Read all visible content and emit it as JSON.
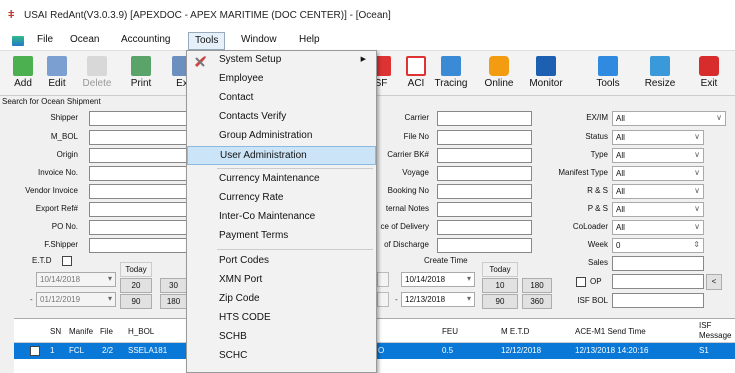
{
  "window": {
    "title": "USAI RedAnt(V3.0.3.9) [APEXDOC - APEX MARITIME (DOC CENTER)] - [Ocean]"
  },
  "menubar": {
    "items": [
      "File",
      "Ocean",
      "Accounting",
      "Tools",
      "Window",
      "Help"
    ]
  },
  "toolbar": {
    "add": "Add",
    "edit": "Edit",
    "delete": "Delete",
    "print": "Print",
    "export": "Ex",
    "isf": "SF",
    "aci": "ACI",
    "tracing": "Tracing",
    "online": "Online",
    "monitor": "Monitor",
    "tools": "Tools",
    "resize": "Resize",
    "exit": "Exit"
  },
  "search": {
    "title": "Search for Ocean Shipment",
    "left_labels": [
      "Shipper",
      "M_BOL",
      "Origin",
      "Invoice No.",
      "Vendor Invoice",
      "Export Ref#",
      "PO No.",
      "F.Shipper"
    ],
    "mid_labels": [
      "Carrier",
      "File No",
      "Carrier BK#",
      "Voyage",
      "Booking No",
      "ternal Notes",
      "ce of Delivery",
      "of Discharge"
    ],
    "right": [
      {
        "label": "EX/IM",
        "value": "All"
      },
      {
        "label": "Status",
        "value": "All"
      },
      {
        "label": "Type",
        "value": "All"
      },
      {
        "label": "Manifest Type",
        "value": "All"
      },
      {
        "label": "R & S",
        "value": "All"
      },
      {
        "label": "P & S",
        "value": "All"
      },
      {
        "label": "CoLoader",
        "value": "All"
      },
      {
        "label": "Week",
        "value": "0"
      }
    ],
    "sales_label": "Sales",
    "op_label": "OP",
    "isf_bol_label": "ISF BOL",
    "etd": {
      "label": "E.T.D",
      "from": "10/14/2018",
      "to": "01/12/2019",
      "today": "Today",
      "b20": "20",
      "b30": "30",
      "b90": "90",
      "b180": "180"
    },
    "create_time": {
      "label": "Create Time",
      "from": "10/14/2018",
      "to": "12/13/2018",
      "today": "Today",
      "b10": "10",
      "b180": "180",
      "b90": "90",
      "b360": "360"
    },
    "scroll_left": "<"
  },
  "grid": {
    "headers": [
      "SN",
      "Manife",
      "File",
      "H_BOL",
      "FEU",
      "M E.T.D",
      "ACE-M1 Send Time",
      "ISF Message"
    ],
    "row": {
      "sn": "1",
      "manifest": "FCL",
      "file": "2/2",
      "hbol": "SSELA181",
      "mid": "O",
      "feu": "0.5",
      "metd": "12/12/2018",
      "ace": "12/13/2018 14:20:16",
      "isf": "S1"
    }
  },
  "tools_menu": {
    "items": [
      "System Setup",
      "Employee",
      "Contact",
      "Contacts Verify",
      "Group Administration",
      "User Administration",
      "Currency Maintenance",
      "Currency Rate",
      "Inter-Co Maintenance",
      "Payment Terms",
      "Port Codes",
      "XMN Port",
      "Zip Code",
      "HTS CODE",
      "SCHB",
      "SCHC"
    ],
    "highlighted": "User Administration"
  },
  "colors": {
    "selection": "#0a78d7",
    "menu_highlight": "#cce4f7"
  }
}
